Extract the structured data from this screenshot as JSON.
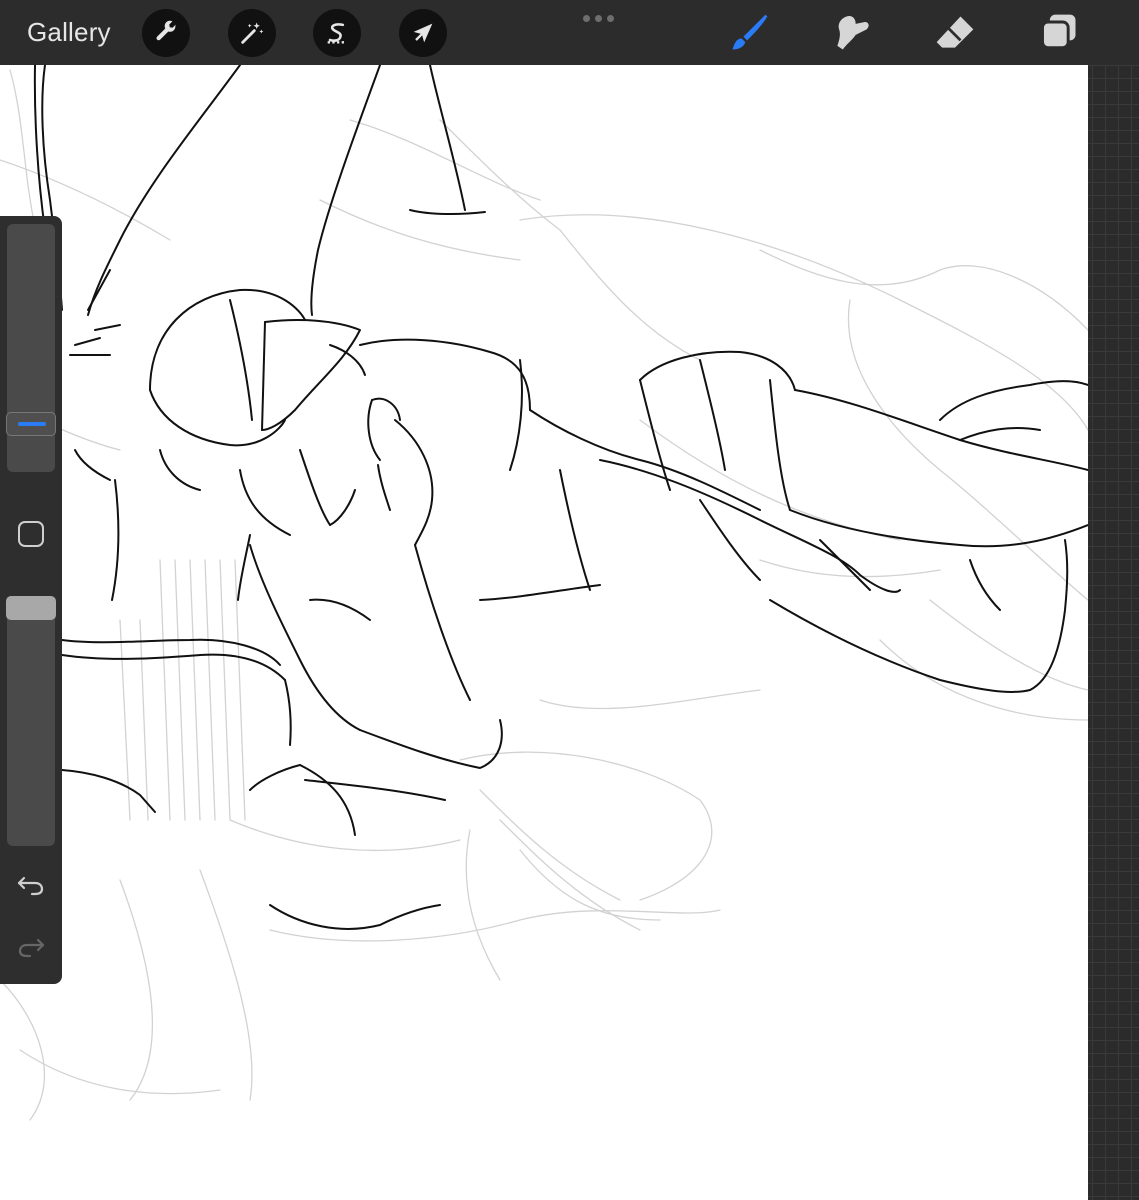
{
  "toolbar": {
    "gallery_label": "Gallery",
    "actions_icon": "wrench-icon",
    "adjustments_icon": "magic-wand-icon",
    "selection_icon": "selection-s-icon",
    "transform_icon": "arrow-cursor-icon",
    "brush_icon": "brush-icon",
    "smudge_icon": "smudge-icon",
    "eraser_icon": "eraser-icon",
    "layers_icon": "layers-icon"
  },
  "sidebar": {
    "brush_size_icon": "slider",
    "modify_icon": "square-icon",
    "undo_icon": "undo-icon",
    "redo_icon": "redo-icon"
  },
  "colors": {
    "accent": "#2a7cf6",
    "toolbar_bg": "#2c2c2c",
    "canvas_bg": "#ffffff"
  }
}
